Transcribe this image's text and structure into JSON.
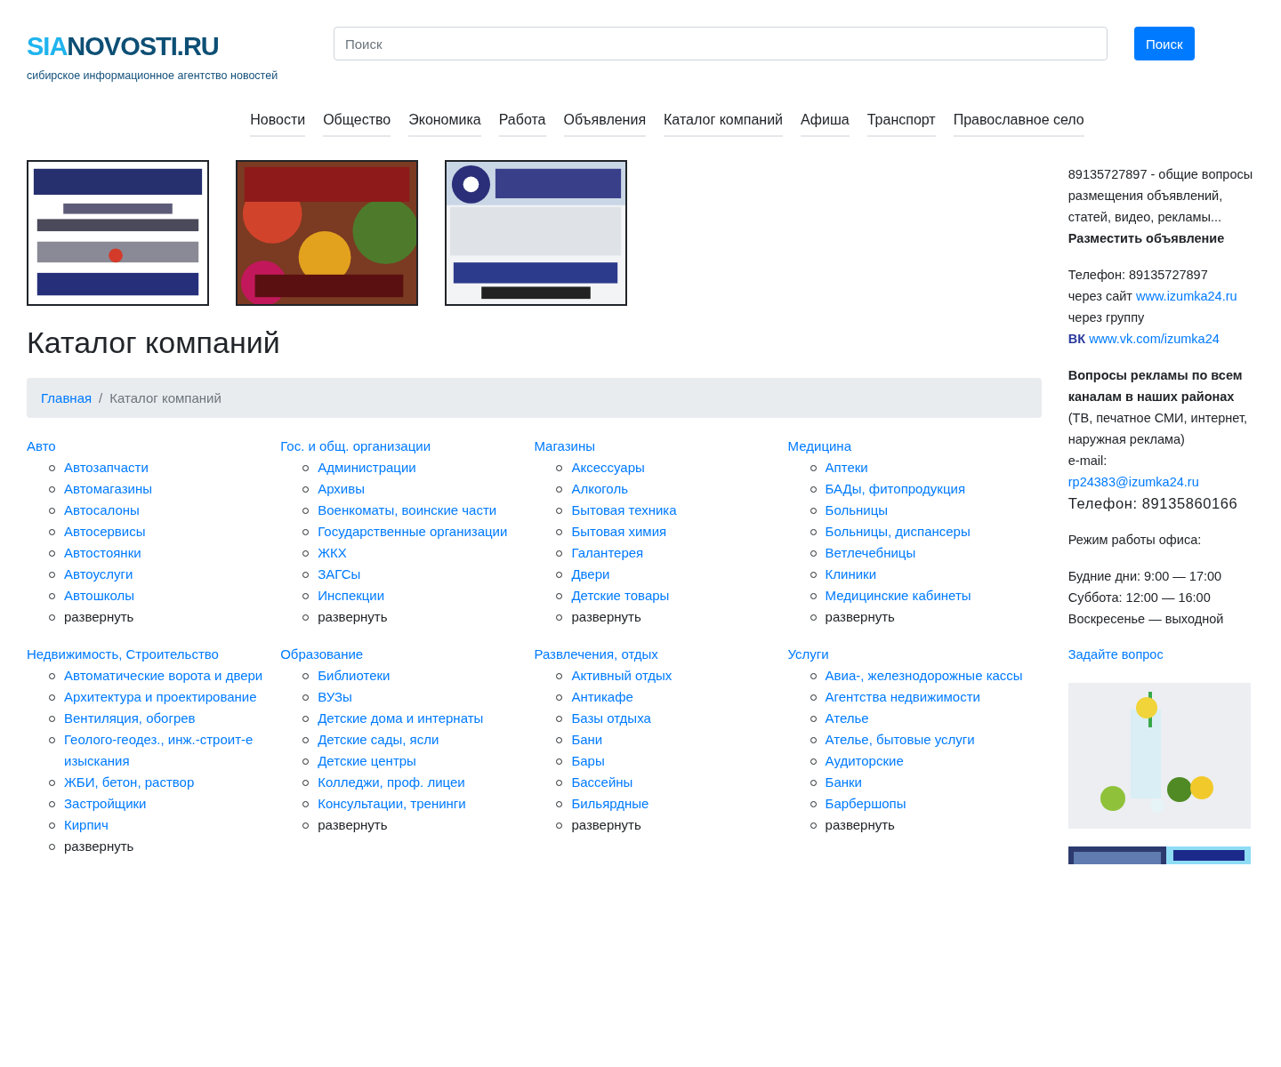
{
  "header": {
    "logo": {
      "accent": "SIA",
      "rest": "NOVOSTI.RU"
    },
    "tagline": "сибирское информационное агентство новостей",
    "search": {
      "placeholder": "Поиск",
      "button": "Поиск"
    }
  },
  "nav": [
    "Новости",
    "Общество",
    "Экономика",
    "Работа",
    "Объявления",
    "Каталог компаний",
    "Афиша",
    "Транспорт",
    "Православное село"
  ],
  "banners": [
    {
      "kind": "picture"
    },
    {
      "kind": "picture"
    },
    {
      "kind": "picture"
    }
  ],
  "page_title": "Каталог компаний",
  "breadcrumb": [
    "Главная",
    "Каталог компаний"
  ],
  "breadcrumb_separator": "/",
  "categories": [
    {
      "title": "Авто",
      "items": [
        "Автозапчасти",
        "Автомагазины",
        "Автосалоны",
        "Автосервисы",
        "Автостоянки",
        "Автоуслуги",
        "Автошколы"
      ],
      "more": "развернуть"
    },
    {
      "title": "Гос. и общ. организации",
      "items": [
        "Администрации",
        "Архивы",
        "Военкоматы, воинские части",
        "Государственные организации",
        "ЖКХ",
        "ЗАГСы",
        "Инспекции"
      ],
      "more": "развернуть"
    },
    {
      "title": "Магазины",
      "items": [
        "Аксессуары",
        "Алкоголь",
        "Бытовая техника",
        "Бытовая химия",
        "Галантерея",
        "Двери",
        "Детские товары"
      ],
      "more": "развернуть"
    },
    {
      "title": "Медицина",
      "items": [
        "Аптеки",
        "БАДы, фитопродукция",
        "Больницы",
        "Больницы, диспансеры",
        "Ветлечебницы",
        "Клиники",
        "Медицинские кабинеты"
      ],
      "more": "развернуть"
    },
    {
      "title": "Недвижимость, Строительство",
      "items": [
        "Автоматические ворота и двери",
        "Архитектура и проектирование",
        "Вентиляция, обогрев",
        "Геолого-геодез., инж.-строит-е изыскания",
        "ЖБИ, бетон, раствор",
        "Застройщики",
        "Кирпич"
      ],
      "more": "развернуть"
    },
    {
      "title": "Образование",
      "items": [
        "Библиотеки",
        "ВУЗы",
        "Детские дома и интернаты",
        "Детские сады, ясли",
        "Детские центры",
        "Колледжи, проф. лицеи",
        "Консультации, тренинги"
      ],
      "more": "развернуть"
    },
    {
      "title": "Развлечения, отдых",
      "items": [
        "Активный отдых",
        "Антикафе",
        "Базы отдыха",
        "Бани",
        "Бары",
        "Бассейны",
        "Бильярдные"
      ],
      "more": "развернуть"
    },
    {
      "title": "Услуги",
      "items": [
        "Авиа-, железнодорожные кассы",
        "Агентства недвижимости",
        "Ателье",
        "Ателье, бытовые услуги",
        "Аудиторские",
        "Банки",
        "Барбершопы"
      ],
      "more": "развернуть"
    }
  ],
  "sidebar": {
    "intro": "89135727897 - общие вопросы размещения объявлений, статей, видео, рекламы...",
    "post_ad": "Разместить объявление",
    "phone": "Телефон: 89135727897",
    "via_site": "через сайт",
    "site_link": "www.izumka24.ru",
    "via_group": "через группу",
    "vk_label": "ВК",
    "vk_link": "www.vk.com/izumka24",
    "ads_heading": "Вопросы рекламы по всем каналам в наших районах",
    "ads_note": "(ТВ, печатное СМИ, интернет, наружная реклама)",
    "email_label": "e-mail:",
    "email": "rp24383@izumka24.ru",
    "phone2": "Телефон: 89135860166",
    "hours_title": "Режим работы офиса:",
    "hours": [
      "Будние дни: 9:00 — 17:00",
      "Суббота: 12:00 — 16:00",
      "Воскресенье — выходной"
    ],
    "ask": "Задайте вопрос",
    "images": [
      {
        "kind": "picture"
      },
      {
        "kind": "picture"
      }
    ]
  }
}
